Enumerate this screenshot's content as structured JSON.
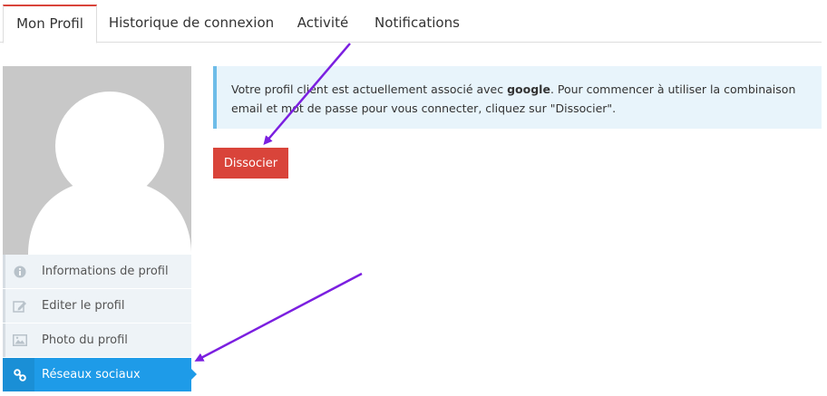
{
  "tabs": [
    {
      "label": "Mon Profil",
      "active": true
    },
    {
      "label": "Historique de connexion",
      "active": false
    },
    {
      "label": "Activité",
      "active": false
    },
    {
      "label": "Notifications",
      "active": false
    }
  ],
  "sidebar": {
    "items": [
      {
        "label": "Informations de profil",
        "icon": "info-icon"
      },
      {
        "label": "Editer le profil",
        "icon": "edit-icon"
      },
      {
        "label": "Photo du profil",
        "icon": "image-icon"
      },
      {
        "label": "Réseaux sociaux",
        "icon": "link-icon",
        "active": true
      }
    ]
  },
  "alert": {
    "text_before": "Votre profil client est actuellement associé avec ",
    "provider": "google",
    "text_after": ". Pour commencer à utiliser la combinaison email et mot de passe pour vous connecter, cliquez sur \"Dissocier\"."
  },
  "actions": {
    "dissociate_label": "Dissocier"
  },
  "colors": {
    "accent_red": "#d9443a",
    "active_blue": "#1e9be8",
    "alert_bg": "#e8f4fb",
    "annotation_arrow": "#7b1fe0"
  }
}
